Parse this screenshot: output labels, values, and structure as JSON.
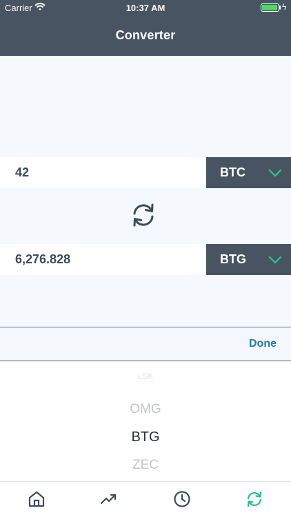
{
  "status_bar": {
    "carrier": "Carrier",
    "time": "10:37 AM",
    "battery_color": "#4cd964"
  },
  "header": {
    "title": "Converter"
  },
  "converter": {
    "from": {
      "amount": "42",
      "currency": "BTC"
    },
    "to": {
      "amount": "6,276.828",
      "currency": "BTG"
    }
  },
  "picker": {
    "done_label": "Done",
    "options": [
      "LSK",
      "OMG",
      "BTG",
      "ZEC"
    ],
    "selected": "BTG"
  },
  "tab_bar": {
    "items": [
      {
        "icon": "home-icon"
      },
      {
        "icon": "trending-icon"
      },
      {
        "icon": "clock-icon"
      },
      {
        "icon": "convert-icon",
        "active": true
      }
    ],
    "active_color": "#2bbf8a"
  },
  "colors": {
    "header": "#485461",
    "accent": "#2bbf8a",
    "link": "#247aa6"
  }
}
